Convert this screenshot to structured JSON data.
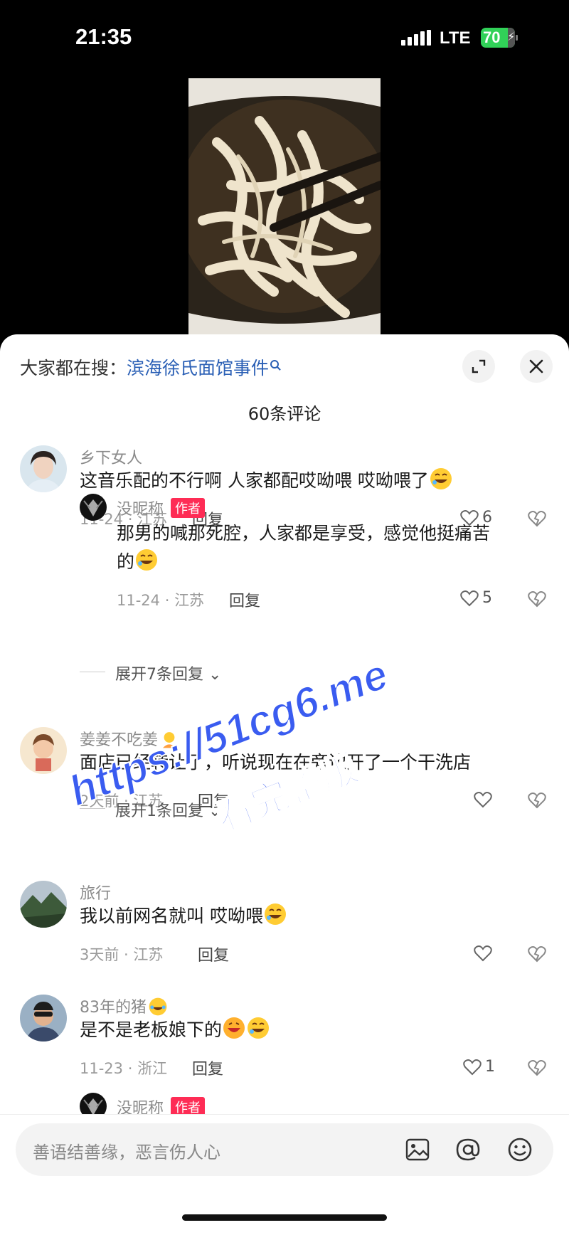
{
  "status_bar": {
    "time": "21:35",
    "network": "LTE",
    "battery": "70"
  },
  "video": {
    "icon": "noodle-bowl-photo"
  },
  "sheet": {
    "search_prefix": "大家都在搜：",
    "search_term": "滨海徐氏面馆事件",
    "comment_count": "60条评论"
  },
  "comments": [
    {
      "name": "乡下女人",
      "text": "这音乐配的不行啊 人家都配哎呦喂 哎呦喂了",
      "date": "11-24",
      "location": "江苏",
      "reply": "回复",
      "likes": "6"
    },
    {
      "name": "没昵称",
      "badge": "作者",
      "text_line1": "那男的喊那死腔，人家都是享受，感觉他挺痛苦",
      "text_line2": "的",
      "date": "11-24",
      "location": "江苏",
      "reply": "回复",
      "likes": "5"
    },
    {
      "expand": "展开7条回复"
    },
    {
      "name": "姜姜不吃姜",
      "text": "面店已经转让了，听说现在在旁边开了一个干洗店",
      "date": "2天前",
      "location": "江苏",
      "reply": "回复",
      "likes": ""
    },
    {
      "expand": "展开1条回复"
    },
    {
      "name": "旅行",
      "text": "我以前网名就叫  哎呦喂",
      "date": "3天前",
      "location": "江苏",
      "reply": "回复",
      "likes": ""
    },
    {
      "name": "83年的猪",
      "text": "是不是老板娘下的",
      "date": "11-23",
      "location": "浙江",
      "reply": "回复",
      "likes": "1"
    },
    {
      "name": "没昵称",
      "badge": "作者"
    }
  ],
  "input": {
    "placeholder": "善语结善缘，恶言伤人心"
  },
  "watermark": {
    "line1": "https://51cg6.me",
    "line2": "看完整版"
  },
  "colors": {
    "accent_red": "#fe2c55",
    "link_blue": "#2a5fb5",
    "watermark_blue": "#3a5cf0"
  }
}
